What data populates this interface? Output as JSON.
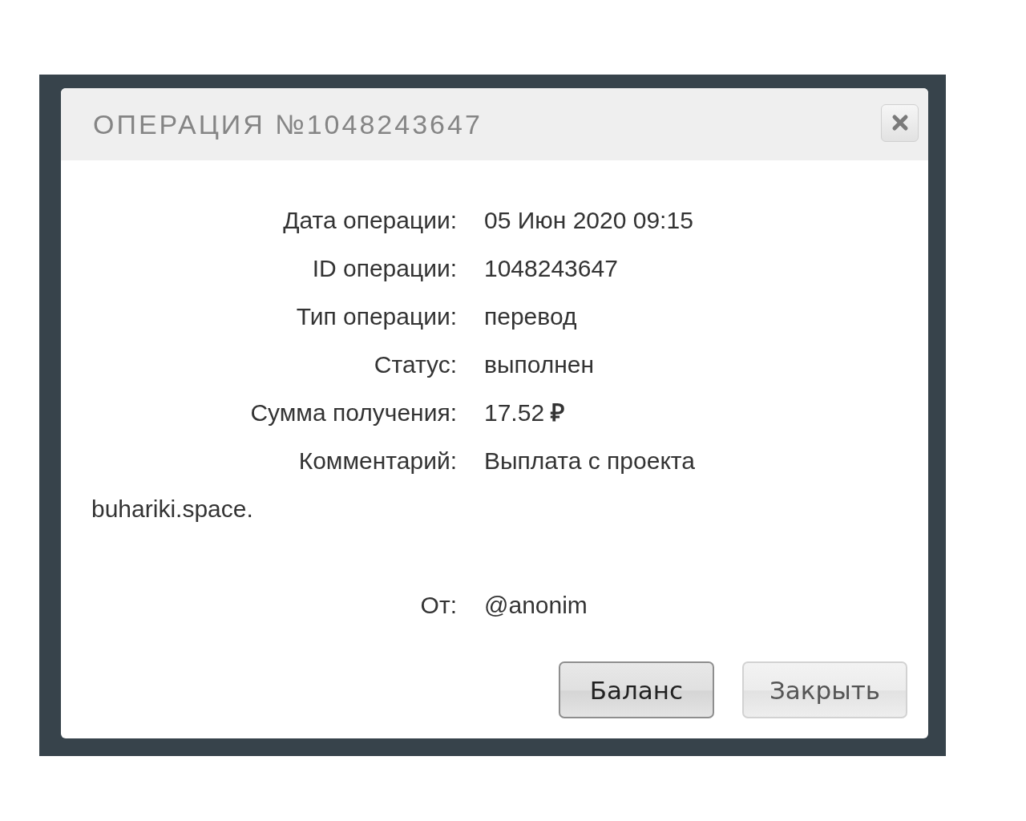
{
  "dialog": {
    "title": "ОПЕРАЦИЯ №1048243647",
    "fields": [
      {
        "label": "Дата операции:",
        "value": "05 Июн 2020 09:15"
      },
      {
        "label": "ID операции:",
        "value": "1048243647"
      },
      {
        "label": "Тип операции:",
        "value": "перевод"
      },
      {
        "label": "Статус:",
        "value": "выполнен"
      },
      {
        "label": "Сумма получения:",
        "value": "17.52 **₽**"
      },
      {
        "label": "Комментарий:",
        "value": "Выплата с проекта",
        "value_continued": "buhariki.space."
      },
      {
        "label": "От:",
        "value": "@anonim",
        "spaced": true
      }
    ],
    "buttons": [
      {
        "label": "Баланс",
        "focused": true
      },
      {
        "label": "Закрыть",
        "focused": false
      }
    ]
  }
}
